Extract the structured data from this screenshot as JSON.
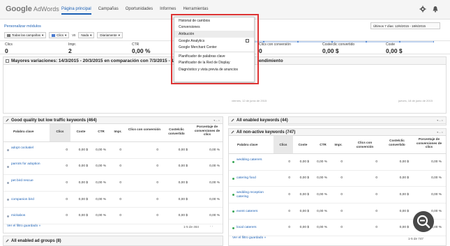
{
  "header": {
    "logo_google": "Google",
    "logo_ads": "AdWords",
    "nav": [
      "Página principal",
      "Campañas",
      "Oportunidades",
      "Informes",
      "Herramientas"
    ]
  },
  "toolbar": {
    "customize_link": "Personalizar módulos",
    "date_range": "Últimos 7 días: 12/6/2015 - 18/6/2015",
    "filter_campaigns": "Todas las campañas",
    "metric1": "Clics",
    "vs_label": "vs",
    "metric2": "Nada",
    "period": "Diariamente"
  },
  "stats": [
    {
      "label": "Clics",
      "value": "0"
    },
    {
      "label": "Impr.",
      "value": "2"
    },
    {
      "label": "CTR",
      "value": "0,00 %"
    },
    {
      "label": "Clics con conversión",
      "value": "0"
    },
    {
      "label": "Coste/clic convertido",
      "value": "0,00 $"
    },
    {
      "label": "Coste",
      "value": "0,00 $"
    }
  ],
  "variations": {
    "title": "Mayores variaciones: 14/3/2015 - 20/3/2015 en comparación con 7/3/2015 - 13/3/2015",
    "perf_title": "endimiento",
    "date_start": "viernes, 12 de junio de 2015",
    "date_end": "jueves, 18 de junio de 2015"
  },
  "menu": {
    "items": [
      "Historial de cambios",
      "Conversiones",
      "Atribución",
      "Google Analytics",
      "Google Merchant Center",
      "Planificador de palabras clave",
      "Planificador de la Red de Display",
      "Diagnóstico y vista previa de anuncios"
    ]
  },
  "columns": {
    "keyword": "Palabra clave",
    "clicks": "Clics",
    "cost": "Coste",
    "ctr": "CTR",
    "impr": "Impr.",
    "conv_clicks": "Clics con conversión",
    "cost_conv": "Coste/clic convertido",
    "conv_rate": "Porcentaje de conversiones de clics"
  },
  "table_left": {
    "title": "Good quality but low traffic keywords (464)",
    "rows": [
      {
        "kw": "adopt cockatiel",
        "clicks": "0",
        "cost": "0,00 $",
        "ctr": "0,00 %",
        "impr": "0",
        "conv": "0",
        "cost_conv": "0,00 $",
        "rate": "0,00 %"
      },
      {
        "kw": "parrots for adoption",
        "clicks": "0",
        "cost": "0,00 $",
        "ctr": "0,00 %",
        "impr": "0",
        "conv": "0",
        "cost_conv": "0,00 $",
        "rate": "0,00 %"
      },
      {
        "kw": "pet bird rescue",
        "clicks": "0",
        "cost": "0,00 $",
        "ctr": "0,00 %",
        "impr": "0",
        "conv": "0",
        "cost_conv": "0,00 $",
        "rate": "0,00 %"
      },
      {
        "kw": "companion bird",
        "clicks": "0",
        "cost": "0,00 $",
        "ctr": "0,00 %",
        "impr": "0",
        "conv": "0",
        "cost_conv": "0,00 $",
        "rate": "0,00 %"
      },
      {
        "kw": "mickabos",
        "clicks": "0",
        "cost": "0,00 $",
        "ctr": "0,00 %",
        "impr": "0",
        "conv": "0",
        "cost_conv": "0,00 $",
        "rate": "0,00 %"
      }
    ],
    "footer_link": "Ver el filtro guardado »",
    "pagination": "1-5 de 464"
  },
  "table_right_top": {
    "title": "All enabled keywords (44)"
  },
  "table_right": {
    "title": "All non-active keywords (747)",
    "rows": [
      {
        "kw": "wedding caterers",
        "clicks": "0",
        "cost": "0,00 $",
        "ctr": "0,00 %",
        "impr": "0",
        "conv": "0",
        "cost_conv": "0,00 $",
        "rate": "0,00 %"
      },
      {
        "kw": "catering food",
        "clicks": "0",
        "cost": "0,00 $",
        "ctr": "0,00 %",
        "impr": "0",
        "conv": "0",
        "cost_conv": "0,00 $",
        "rate": "0,00 %"
      },
      {
        "kw": "wedding reception catering",
        "clicks": "0",
        "cost": "0,00 $",
        "ctr": "0,00 %",
        "impr": "0",
        "conv": "0",
        "cost_conv": "0,00 $",
        "rate": "0,00 %"
      },
      {
        "kw": "event caterers",
        "clicks": "0",
        "cost": "0,00 $",
        "ctr": "0,00 %",
        "impr": "0",
        "conv": "0",
        "cost_conv": "0,00 $",
        "rate": "0,00 %"
      },
      {
        "kw": "local caterers",
        "clicks": "0",
        "cost": "0,00 $",
        "ctr": "0,00 %",
        "impr": "0",
        "conv": "0",
        "cost_conv": "0,00 $",
        "rate": "0,00 %"
      }
    ],
    "footer_link": "Ver el filtro guardado »",
    "pagination": "1-5 de 747"
  },
  "adgroups": {
    "title": "All enabled ad groups (8)"
  },
  "colors": {
    "link": "#1a5fb4",
    "highlight_box": "#dd3333",
    "active_bullet": "#3aa757",
    "inactive_bullet": "#9aa6b8"
  }
}
